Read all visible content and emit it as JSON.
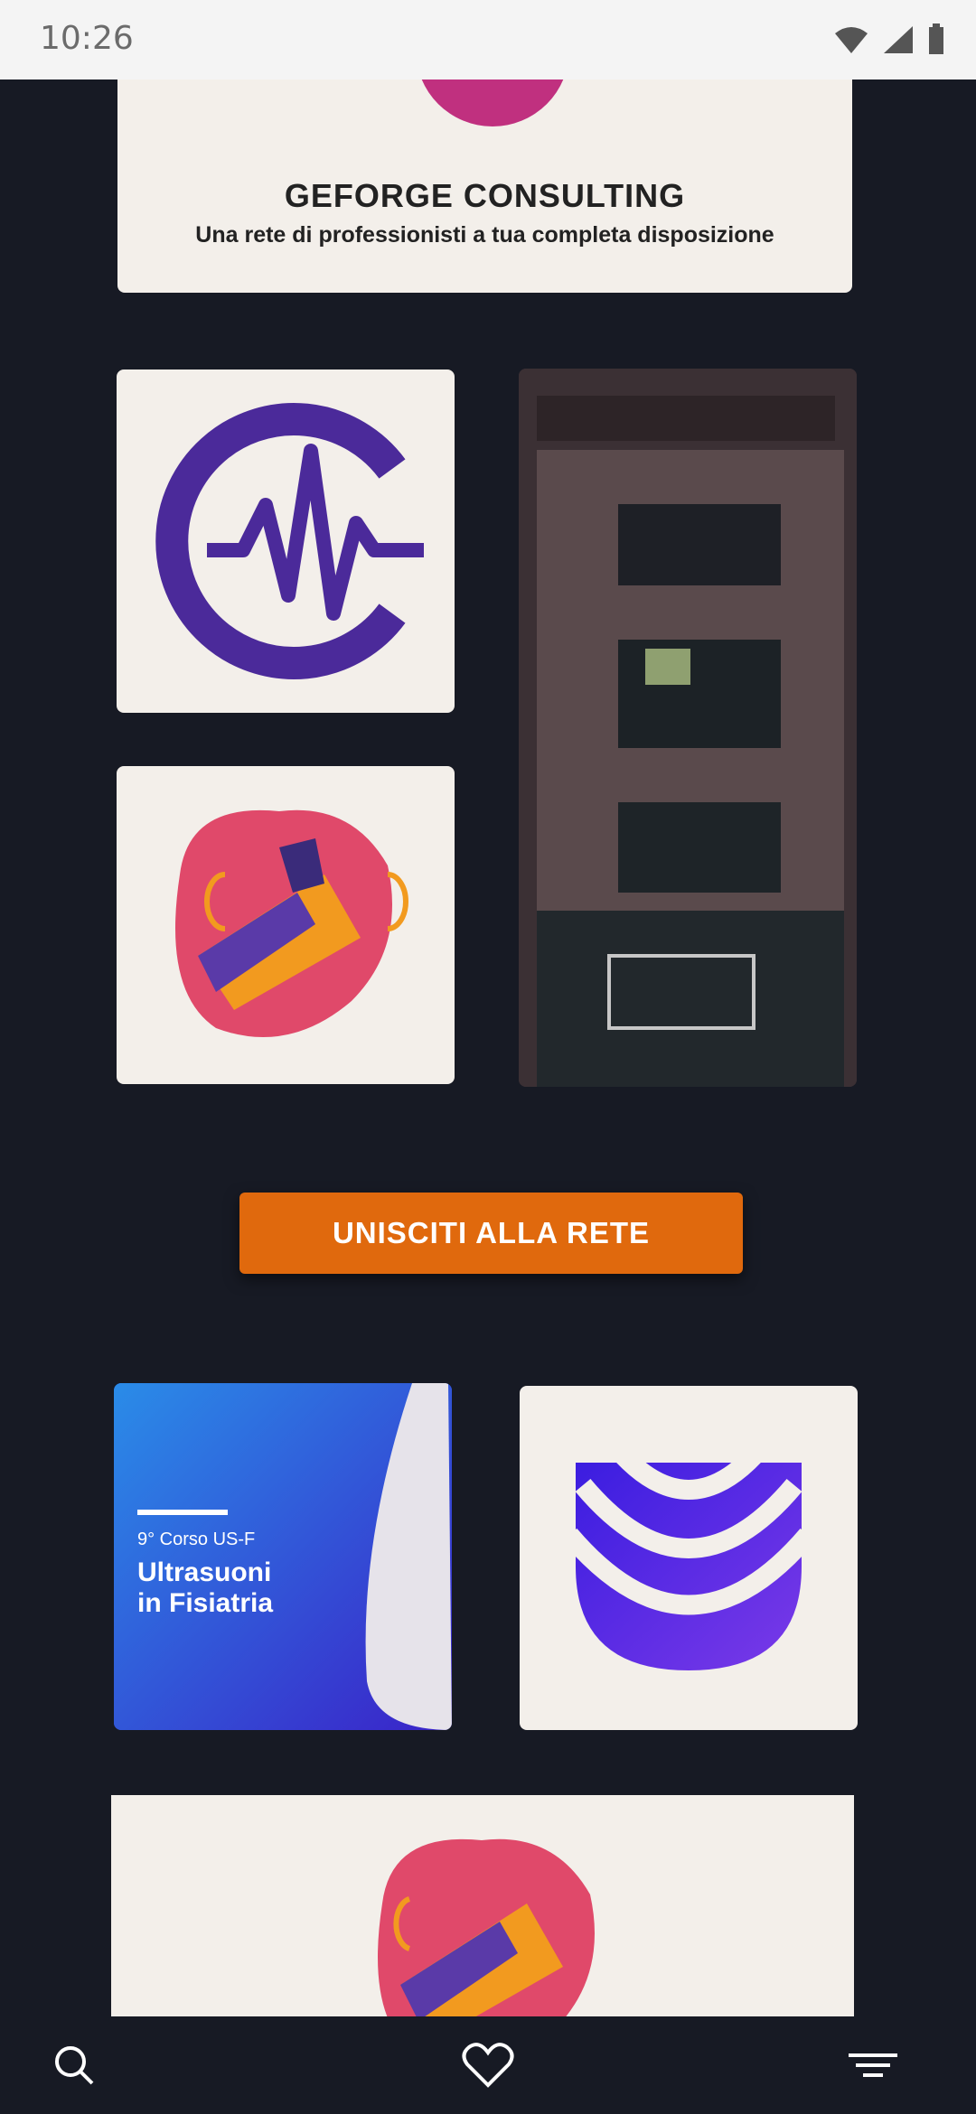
{
  "status_bar": {
    "time": "10:26",
    "icons": [
      "wifi-icon",
      "signal-icon",
      "battery-icon"
    ]
  },
  "hero": {
    "title": "GEFORGE CONSULTING",
    "subtitle": "Una rete di professionisti a tua completa disposizione"
  },
  "cta": {
    "label": "UNISCITI ALLA RETE"
  },
  "promo": {
    "course": "9° Corso US-F",
    "title": "Ultrasuoni\nin Fisiatria"
  },
  "nav": {
    "items": [
      "search-icon",
      "heart-icon",
      "menu-icon"
    ]
  },
  "colors": {
    "background": "#171a24",
    "accent": "#e0690d",
    "brand_purple": "#4b2a9a"
  }
}
